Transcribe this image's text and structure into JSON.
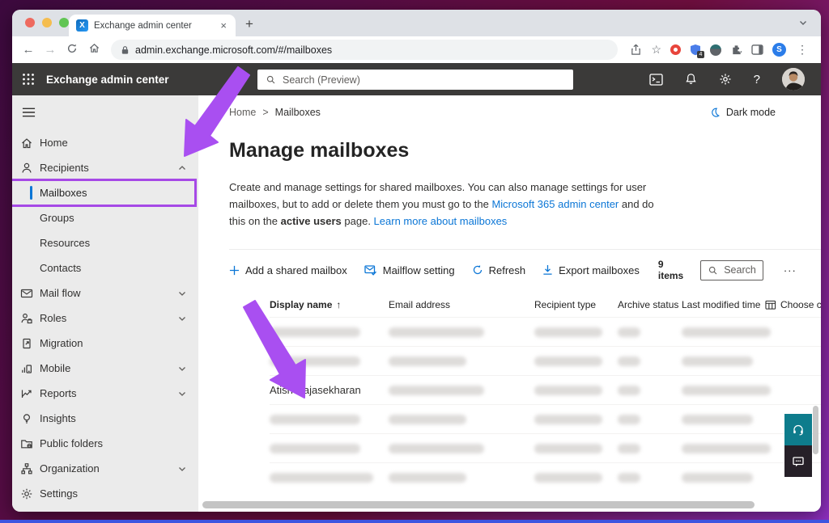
{
  "colors": {
    "accent": "#0b76d6",
    "annotation": "#a94ff1",
    "highlight_box": "#a649e6",
    "support_teal": "#0e7c8c",
    "header_bg": "#3b3a39"
  },
  "browser": {
    "tab_title": "Exchange admin center",
    "tab_close": "×",
    "new_tab": "+",
    "url": "admin.exchange.microsoft.com/#/mailboxes",
    "extension_badge": "4",
    "favicon_letter": "X"
  },
  "eac_header": {
    "title": "Exchange admin center",
    "search_placeholder": "Search (Preview)",
    "help_label": "?"
  },
  "sidebar": {
    "items": [
      {
        "label": "Home",
        "icon": "home-icon"
      },
      {
        "label": "Recipients",
        "icon": "person-icon",
        "chevron": "up"
      },
      {
        "label": "Mailboxes",
        "child": true,
        "selected": true,
        "highlighted": true
      },
      {
        "label": "Groups",
        "child": true
      },
      {
        "label": "Resources",
        "child": true
      },
      {
        "label": "Contacts",
        "child": true
      },
      {
        "label": "Mail flow",
        "icon": "mail-icon",
        "chevron": "down"
      },
      {
        "label": "Roles",
        "icon": "roles-icon",
        "chevron": "down"
      },
      {
        "label": "Migration",
        "icon": "migration-icon"
      },
      {
        "label": "Mobile",
        "icon": "mobile-icon",
        "chevron": "down"
      },
      {
        "label": "Reports",
        "icon": "reports-icon",
        "chevron": "down"
      },
      {
        "label": "Insights",
        "icon": "insights-icon"
      },
      {
        "label": "Public folders",
        "icon": "folder-icon"
      },
      {
        "label": "Organization",
        "icon": "org-icon",
        "chevron": "down"
      },
      {
        "label": "Settings",
        "icon": "settings-icon"
      }
    ]
  },
  "main": {
    "breadcrumb": {
      "home": "Home",
      "separator": ">",
      "current": "Mailboxes"
    },
    "dark_mode_label": "Dark mode",
    "page_title": "Manage mailboxes",
    "description": {
      "text_1": "Create and manage settings for shared mailboxes. You can also manage settings for user mailboxes, but to add or delete them you must go to the ",
      "link_1": "Microsoft 365 admin center",
      "text_2": " and do this on the ",
      "bold_1": "active users",
      "text_3": " page. ",
      "link_2": "Learn more about mailboxes"
    },
    "toolbar": {
      "add": "Add a shared mailbox",
      "mailflow": "Mailflow setting",
      "refresh": "Refresh",
      "export": "Export mailboxes",
      "count": "9 items",
      "search_placeholder": "Search",
      "more": "···"
    },
    "table": {
      "headers": [
        "Display name",
        "Email address",
        "Recipient type",
        "Archive status",
        "Last modified time",
        "Choose co"
      ],
      "sort_indicator": "↑",
      "rows": [
        {
          "display_name": "",
          "redacted": true
        },
        {
          "display_name": "",
          "redacted": true
        },
        {
          "display_name": "Atish Rajasekharan",
          "redacted": false
        },
        {
          "display_name": "",
          "redacted": true
        },
        {
          "display_name": "",
          "redacted": true
        },
        {
          "display_name": "",
          "redacted": true
        }
      ]
    }
  }
}
